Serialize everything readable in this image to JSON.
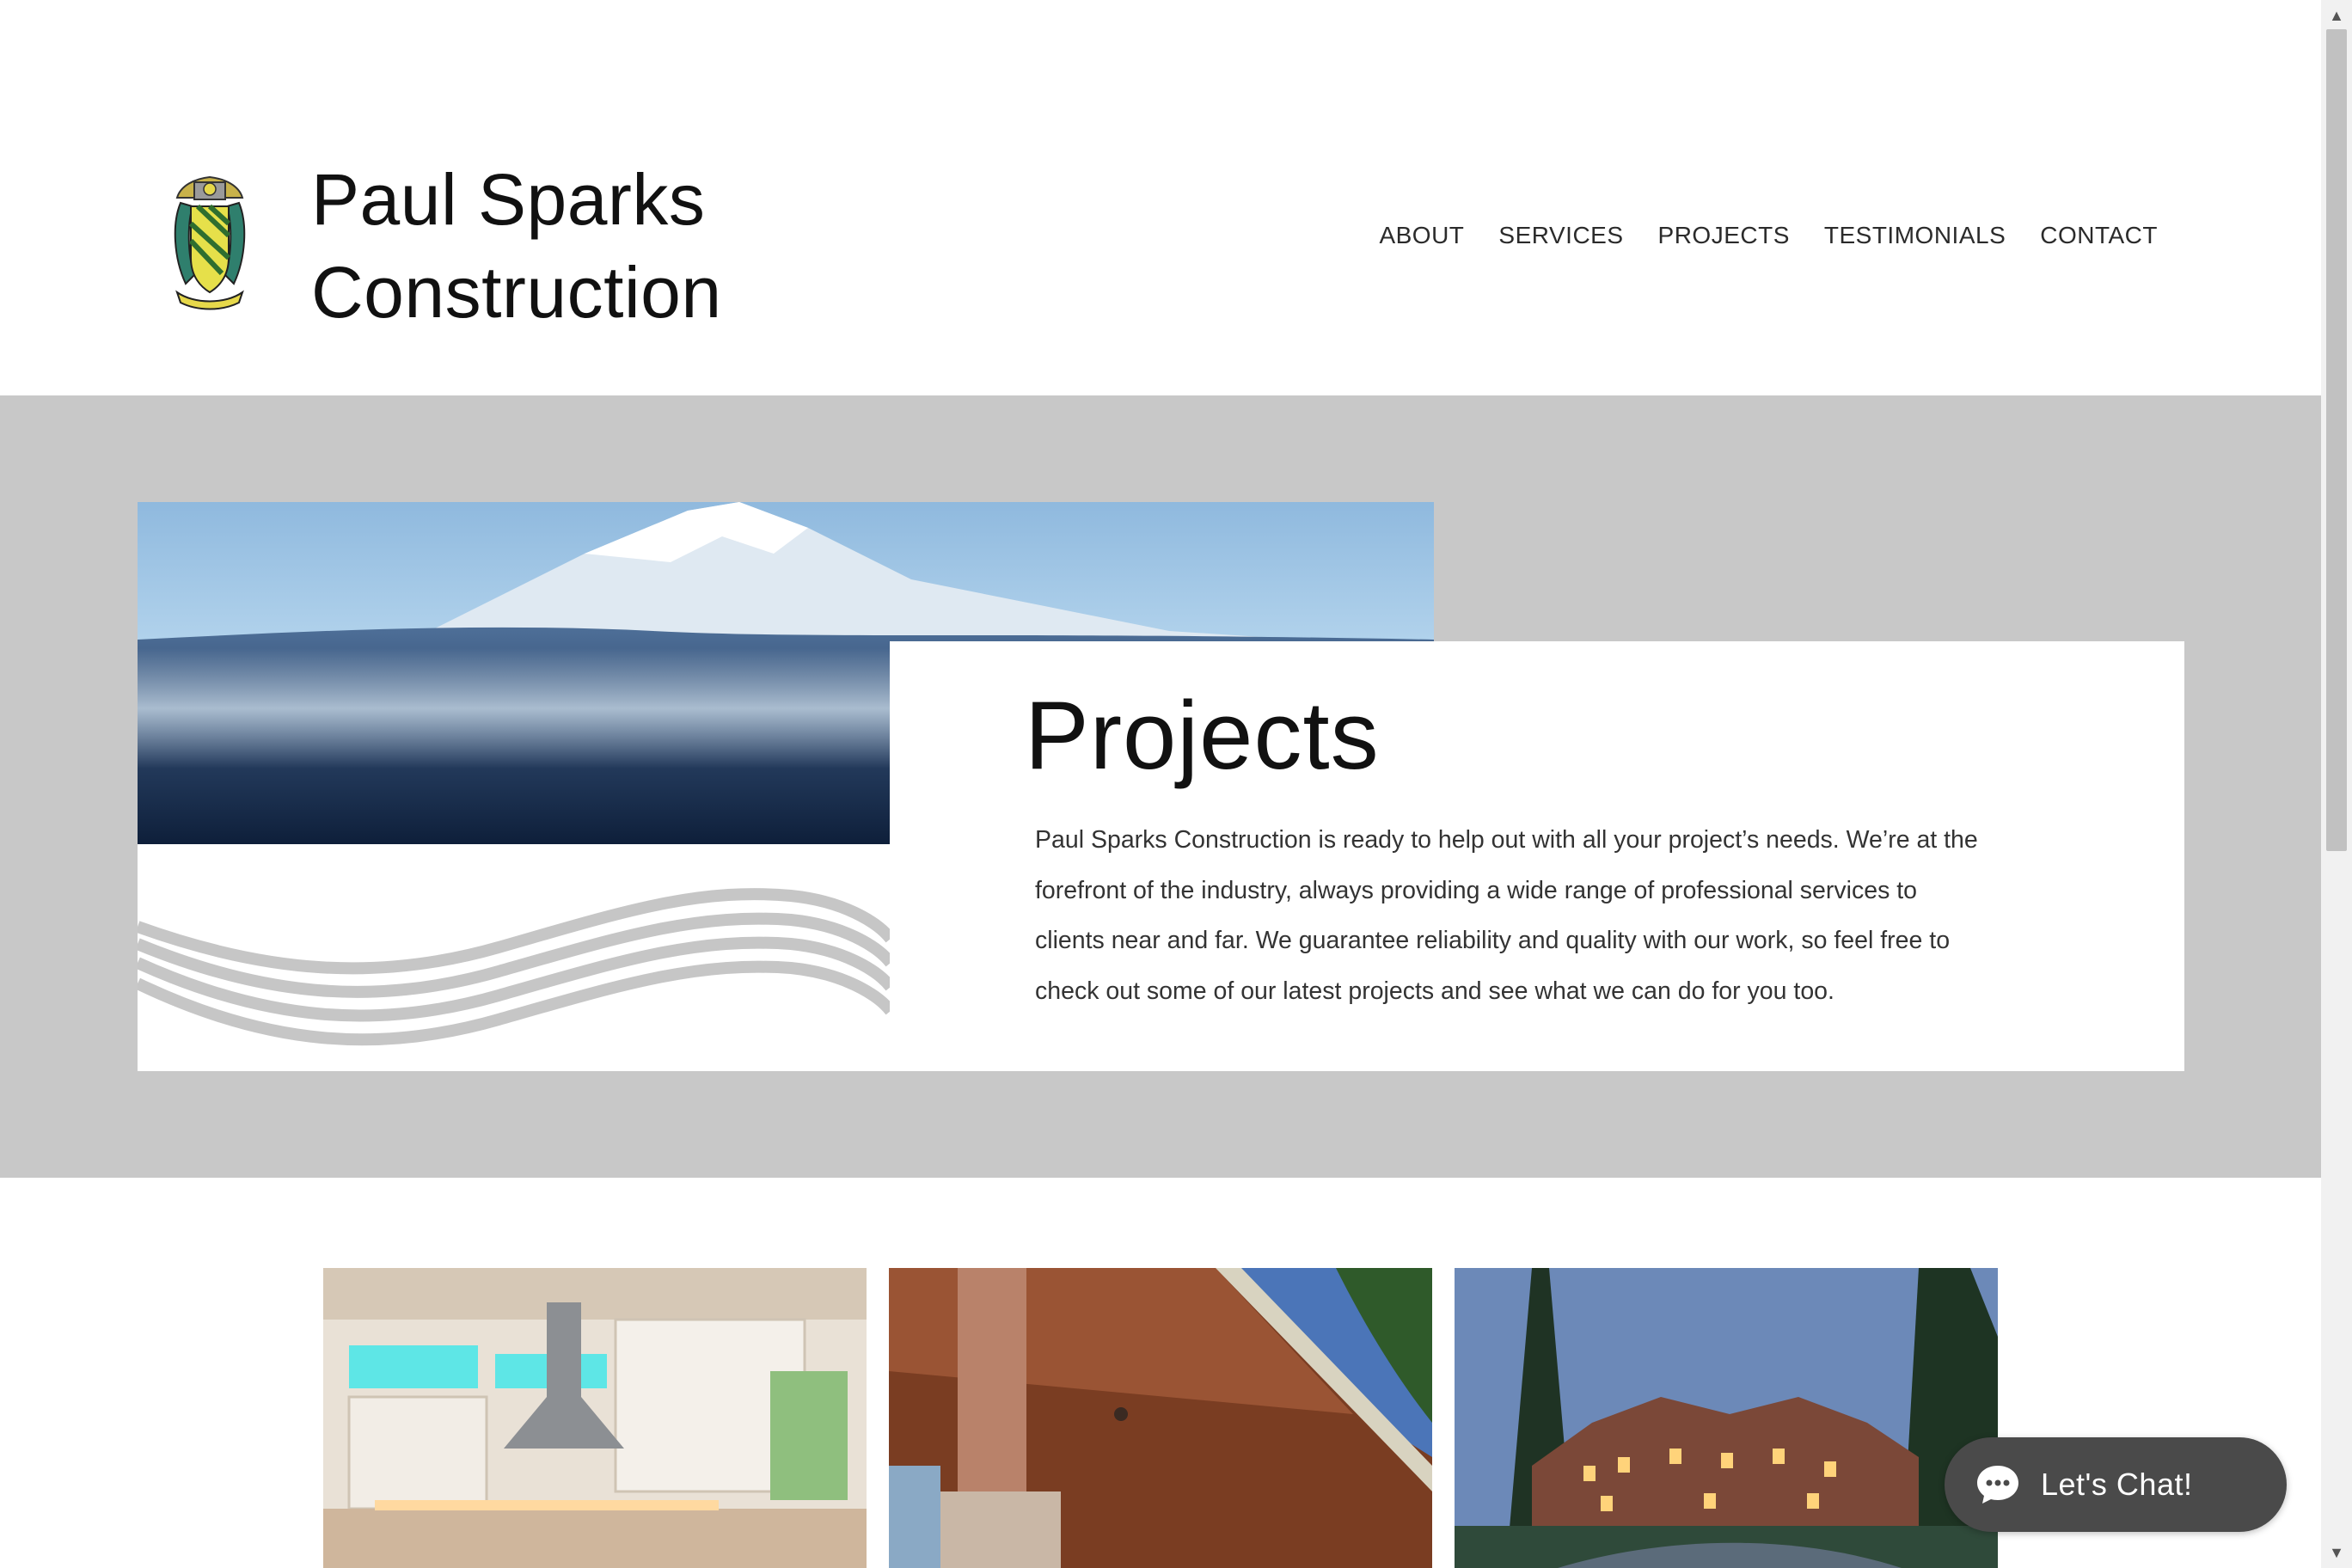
{
  "header": {
    "title_line1": "Paul Sparks",
    "title_line2": "Construction",
    "logo_icon": "family-crest-logo",
    "nav": [
      "ABOUT",
      "SERVICES",
      "PROJECTS",
      "TESTIMONIALS",
      "CONTACT"
    ]
  },
  "hero": {
    "heading": "Projects",
    "body": "Paul Sparks Construction is ready to help out with all your project’s needs. We’re at the forefront of the industry, always providing a wide range of professional services to clients near and far. We guarantee reliability and quality with our work, so feel free to check out some of our latest projects and see what we can do for you too.",
    "image_icon": "misty-mountain-photo",
    "band_color": "#c8c8c8"
  },
  "gallery": {
    "items": [
      {
        "icon": "kitchen-photo"
      },
      {
        "icon": "porch-ceiling-photo"
      },
      {
        "icon": "manor-house-photo"
      }
    ]
  },
  "chat": {
    "label": "Let's Chat!",
    "icon": "chat-bubble-icon",
    "color": "#4a4a4a"
  },
  "scrollbar": {
    "up_glyph": "▲",
    "down_glyph": "▼"
  }
}
